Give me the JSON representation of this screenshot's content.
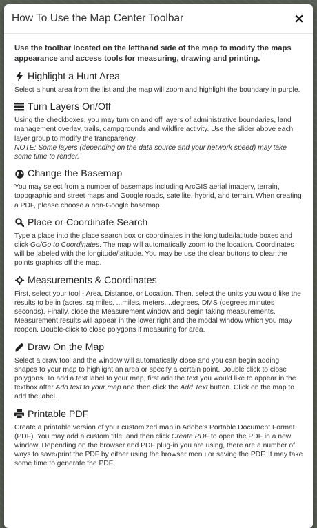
{
  "modal": {
    "title": "How To Use the Map Center Toolbar",
    "close_label": "×",
    "intro": "Use the toolbar located on the lefthand side of the map to modify the maps appearance and access tools for measuring, drawing and printing."
  },
  "sections": {
    "hunt": {
      "icon": "bolt-icon",
      "heading": "Highlight a Hunt Area",
      "text": "Select a hunt area from the list and the map will zoom and highlight the boundary in purple."
    },
    "layers": {
      "icon": "list-icon",
      "heading": "Turn Layers On/Off",
      "text": "Using the checkboxes, you may turn on and off layers of administrative boundaries, land management overlay, trails, campgrounds and wildfire activity. Use the slider above each layer group to modify the transparency.",
      "note": "NOTE: Some layers (depending on the data source and your network speed) may take some time to render."
    },
    "basemap": {
      "icon": "globe-icon",
      "heading": "Change the Basemap",
      "text": "You may select from a number of basemaps including ArcGIS aerial imagery, terrain, topographic and street maps and Google roads, satellite, hybrid, and terrain. When creating a PDF, please choose a non-Google basemap."
    },
    "search": {
      "icon": "search-icon",
      "heading": "Place or Coordinate Search",
      "text_1": "Type a place into the place search box or coordinates in the longitude/latitude boxes and click ",
      "em_1": "Go/Go to Coordinates",
      "text_2": ". The map will automatically zoom to the location. Coordinates will be labeled with the longitude/latitude. You may be use the clear buttons to clear the points graphics off the map."
    },
    "measure": {
      "icon": "crosshair-icon",
      "heading": "Measurements & Coordinates",
      "text": "First, select your tool - Area, Distance, or Location. Then, select the units you would like the results to be in (acres, sq miles, ...miles, meters,...degrees, DMS (degrees minutes seconds). Finally, close the Measurement window and begin taking measurements. Measurement results will appear in the lower right and the modal window which you may reopen. Double-click to close polygons if measuring for area."
    },
    "draw": {
      "icon": "pencil-icon",
      "heading": "Draw On the Map",
      "text_1": "Select a draw tool and the window will automatically close and you can begin adding shapes to your map to highlight an area or specify a certain point. Double click to close polygons. To add a text label to your map, first add the text you would like to appear in the textbox after ",
      "em_1": "Add text to your map",
      "text_2": " and then click the ",
      "em_2": "Add Text",
      "text_3": " button. Click on the map to add the label."
    },
    "print": {
      "icon": "print-icon",
      "heading": "Printable PDF",
      "text_1": "Create a printable version of your customized map in Adobe's Portable Document Format (PDF). You may add a custom title, and then click ",
      "em_1": "Create PDF",
      "text_2": " to open the PDF in a new window. Depending on the browser and PDF plug-in you are using, there are a number of ways to save/print the PDF by either using the browser menu or saving the PDF. It may take some time to generate the PDF."
    }
  }
}
